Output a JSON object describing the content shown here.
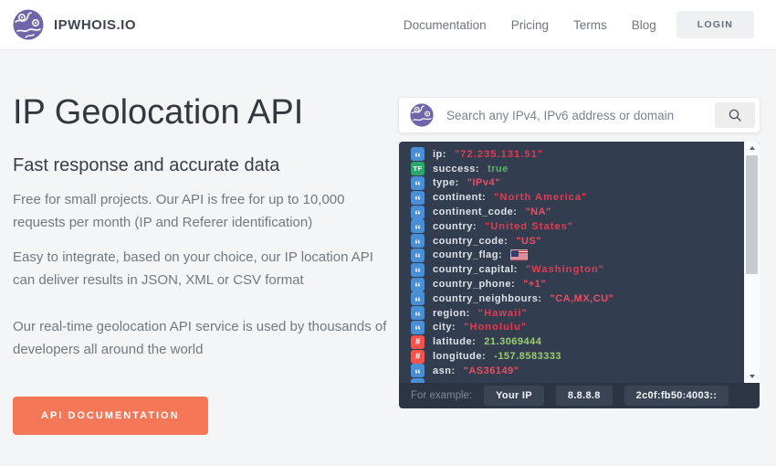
{
  "header": {
    "brand": "IPWHOIS.IO",
    "nav": [
      {
        "label": "Documentation"
      },
      {
        "label": "Pricing"
      },
      {
        "label": "Terms"
      },
      {
        "label": "Blog"
      }
    ],
    "login_label": "LOGIN"
  },
  "hero": {
    "title": "IP Geolocation API",
    "subtitle": "Fast response and accurate data",
    "paragraphs": [
      "Free for small projects. Our API is free for up to 10,000 requests per month (IP and Referer identification)",
      "Easy to integrate, based on your choice, our IP location API can deliver results in JSON, XML or CSV format",
      "Our real-time geolocation API service is used by thousands of developers all around the world"
    ],
    "cta_label": "API DOCUMENTATION"
  },
  "search": {
    "placeholder": "Search any IPv4, IPv6 address or domain",
    "value": "",
    "logo_icon": "globe-pins-icon",
    "button_icon": "magnifier-icon"
  },
  "result": {
    "badge_glyphs": {
      "string": "“",
      "boolean": "TF",
      "number": "#"
    },
    "rows": [
      {
        "type": "string",
        "key": "ip",
        "value": "\"72.235.131.51\"",
        "bold": true
      },
      {
        "type": "boolean",
        "key": "success",
        "value": "true"
      },
      {
        "type": "string",
        "key": "type",
        "value": "\"IPv4\""
      },
      {
        "type": "string",
        "key": "continent",
        "value": "\"North America\"",
        "bold": true
      },
      {
        "type": "string",
        "key": "continent_code",
        "value": "\"NA\""
      },
      {
        "type": "string",
        "key": "country",
        "value": "\"United States\"",
        "bold": true
      },
      {
        "type": "string",
        "key": "country_code",
        "value": "\"US\""
      },
      {
        "type": "string",
        "key": "country_flag",
        "value": "",
        "flag": "us-flag-icon"
      },
      {
        "type": "string",
        "key": "country_capital",
        "value": "\"Washington\"",
        "bold": true
      },
      {
        "type": "string",
        "key": "country_phone",
        "value": "\"+1\""
      },
      {
        "type": "string",
        "key": "country_neighbours",
        "value": "\"CA,MX,CU\""
      },
      {
        "type": "string",
        "key": "region",
        "value": "\"Hawaii\"",
        "bold": true
      },
      {
        "type": "string",
        "key": "city",
        "value": "\"Honolulu\"",
        "bold": true
      },
      {
        "type": "number",
        "key": "latitude",
        "value": "21.3069444"
      },
      {
        "type": "number",
        "key": "longitude",
        "value": "-157.8583333"
      },
      {
        "type": "string",
        "key": "asn",
        "value": "\"AS36149\""
      },
      {
        "type": "string",
        "key": "",
        "value": "",
        "partial": true
      }
    ]
  },
  "examples": {
    "label": "For example:",
    "buttons": [
      "Your IP",
      "8.8.8.8",
      "2c0f:fb50:4003::"
    ]
  },
  "colors": {
    "brand_purple": "#6e66a8",
    "cta_orange": "#f47757",
    "hero_bg": "#f4f5f7",
    "panel_bg": "#323d50",
    "example_bar_bg": "#2b3544",
    "string_value": "#e75062",
    "boolean_value": "#61b06b",
    "number_value": "#9ccd70",
    "badge_string": "#4a8fd5",
    "badge_boolean": "#29a86d",
    "badge_number": "#f0544c"
  }
}
